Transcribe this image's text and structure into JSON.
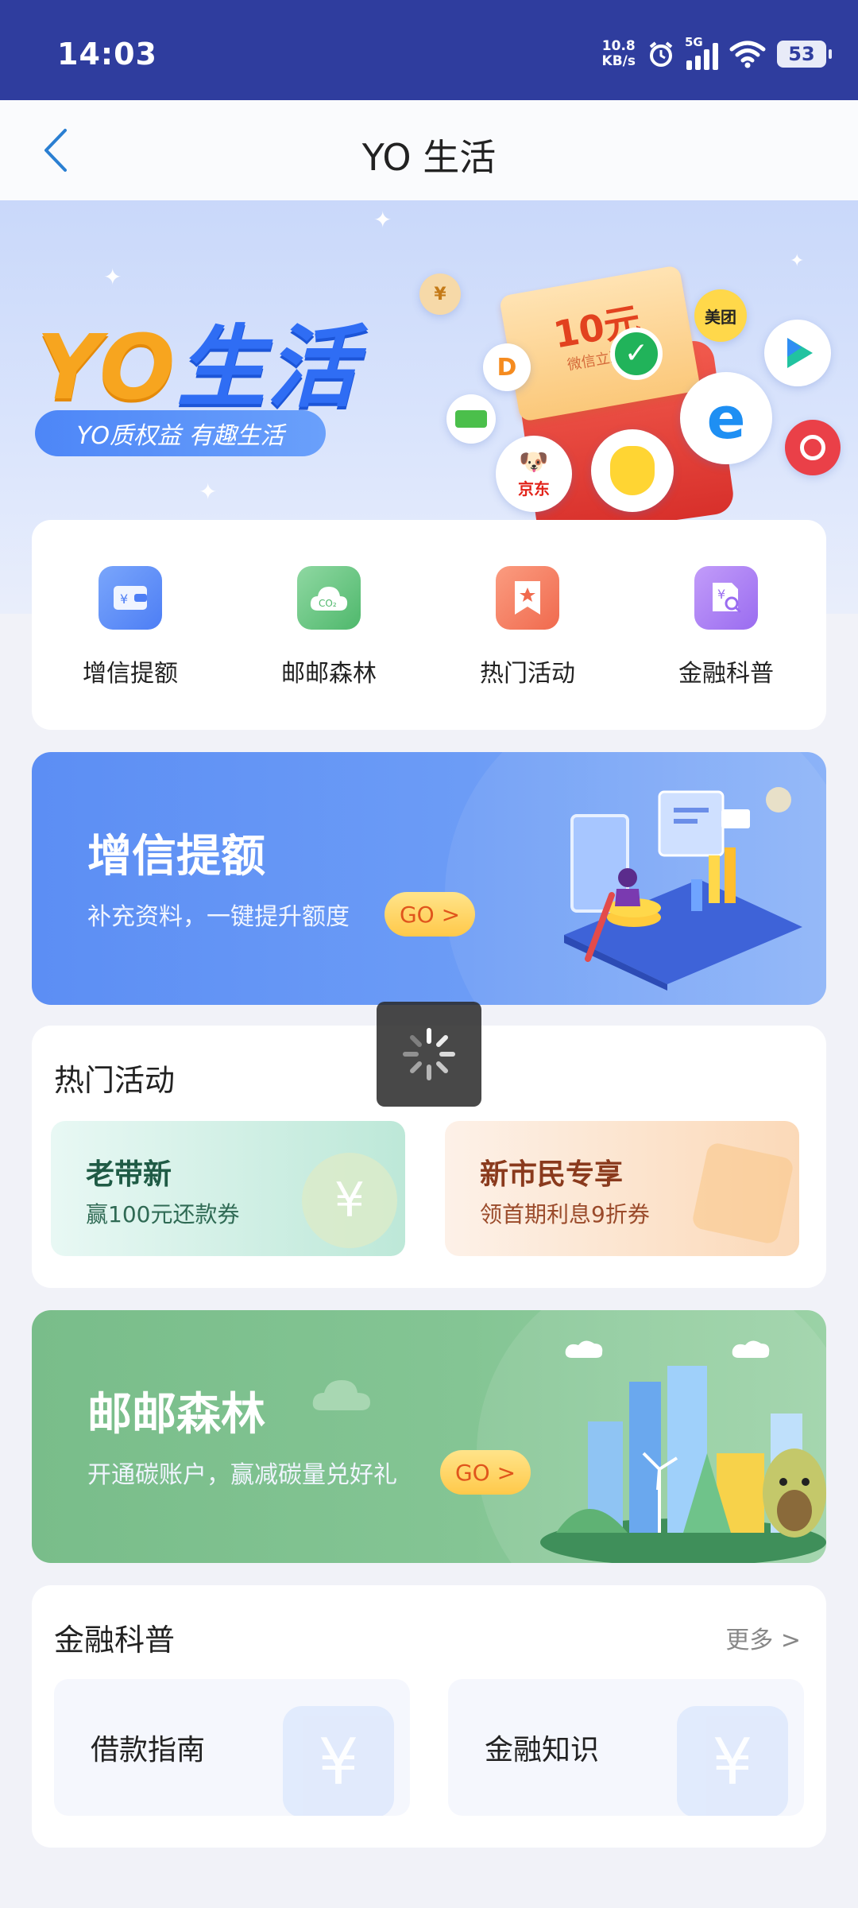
{
  "status_bar": {
    "time": "14:03",
    "net_speed_value": "10.8",
    "net_speed_unit": "KB/s",
    "network": "5G",
    "battery": "53"
  },
  "nav": {
    "title": "YO 生活"
  },
  "banner": {
    "title_yo": "YO",
    "title_sh": "生活",
    "tagline": "YO质权益 有趣生活",
    "coupon_amount": "10元",
    "coupon_sub": "微信立减金",
    "brand_meituan": "美团",
    "brand_jd": "京东"
  },
  "quick_actions": [
    {
      "label": "增信提额",
      "icon": "wallet-icon"
    },
    {
      "label": "邮邮森林",
      "icon": "co2-cloud-icon"
    },
    {
      "label": "热门活动",
      "icon": "bookmark-star-icon"
    },
    {
      "label": "金融科普",
      "icon": "finance-search-icon"
    }
  ],
  "promo_credit": {
    "title": "增信提额",
    "subtitle": "补充资料，一键提升额度",
    "go": "GO >"
  },
  "hot": {
    "title": "热门活动",
    "cards": [
      {
        "title": "老带新",
        "subtitle": "赢100元还款券"
      },
      {
        "title": "新市民专享",
        "subtitle": "领首期利息9折券"
      }
    ]
  },
  "promo_forest": {
    "title": "邮邮森林",
    "subtitle": "开通碳账户，赢减碳量兑好礼",
    "go": "GO >"
  },
  "finance": {
    "title": "金融科普",
    "more": "更多 >",
    "cards": [
      {
        "title": "借款指南"
      },
      {
        "title": "金融知识"
      }
    ]
  },
  "colors": {
    "status_bar": "#2f3d9e",
    "accent_blue": "#2f6df4",
    "accent_orange": "#f7a51f",
    "credit_banner": "#5c8ef4",
    "forest_banner": "#79bd8a"
  }
}
